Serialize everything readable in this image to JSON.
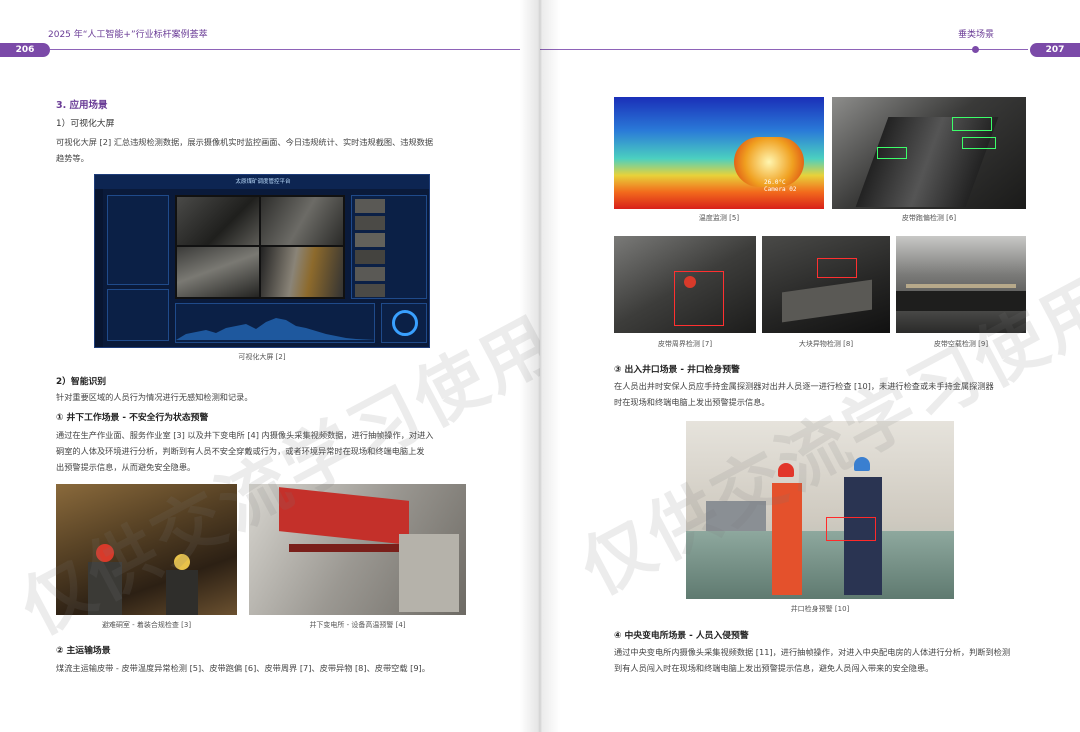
{
  "left_page": {
    "header_title": "2025 年“人工智能+”行业标杆案例荟萃",
    "page_number": "206",
    "section_title": "3. 应用场景",
    "sub1_title": "1）可视化大屏",
    "sub1_text_line1": "可视化大屏 [2] 汇总违规检测数据，展示摄像机实时监控画面、今日违规统计、实时违规截图、违规数据",
    "sub1_text_line2": "趋势等。",
    "dashboard_title": "太原煤矿调度管控平台",
    "fig2_caption": "可视化大屏 [2]",
    "sub2_title": "2）智能识别",
    "sub2_text": "针对重要区域的人员行为情况进行无感知检测和记录。",
    "scene1_title": "① 井下工作场景 - 不安全行为状态预警",
    "scene1_line1": "通过在生产作业面、服务作业室 [3] 以及井下变电所 [4] 内摄像头采集视频数据，进行抽帧操作，对进入",
    "scene1_line2": "硐室的人体及环境进行分析，判断到有人员不安全穿戴或行为，或者环境异常时在现场和终端电脑上发",
    "scene1_line3": "出预警提示信息，从而避免安全隐患。",
    "fig3_caption": "避难硐室 - 着装合规检查 [3]",
    "fig4_caption": "井下变电所 - 设备高温预警 [4]",
    "scene2_title": "② 主运输场景",
    "scene2_text": "煤流主运输皮带 - 皮带温度异常检测 [5]、皮带跑偏 [6]、皮带周界 [7]、皮带异物 [8]、皮带空载 [9]。"
  },
  "right_page": {
    "header_title": "垂类场景",
    "page_number": "207",
    "fig5_caption": "温度监测 [5]",
    "fig5_overlay": "26.0°C\nCamera 02",
    "fig6_caption": "皮带跑偏检测 [6]",
    "fig7_caption": "皮带周界检测 [7]",
    "fig8_caption": "大块异物检测 [8]",
    "fig9_caption": "皮带空载检测 [9]",
    "scene3_title": "③ 出入井口场景 - 井口检身预警",
    "scene3_line1": "在人员出井时安保人员应手持金属探测器对出井人员逐一进行检查 [10]，未进行检查或未手持金属探测器",
    "scene3_line2": "时在现场和终端电脑上发出预警提示信息。",
    "fig10_caption": "井口检身预警 [10]",
    "scene4_title": "④ 中央变电所场景 - 人员入侵预警",
    "scene4_line1": "通过中央变电所内摄像头采集视频数据 [11]，进行抽帧操作，对进入中央配电房的人体进行分析，判断到检测",
    "scene4_line2": "到有人员闯入时在现场和终端电脑上发出预警提示信息，避免人员闯入带来的安全隐患。"
  },
  "watermark": "仅供交流学习使用",
  "colors": {
    "accent": "#7b4aa8",
    "header_text": "#6a3c96"
  }
}
